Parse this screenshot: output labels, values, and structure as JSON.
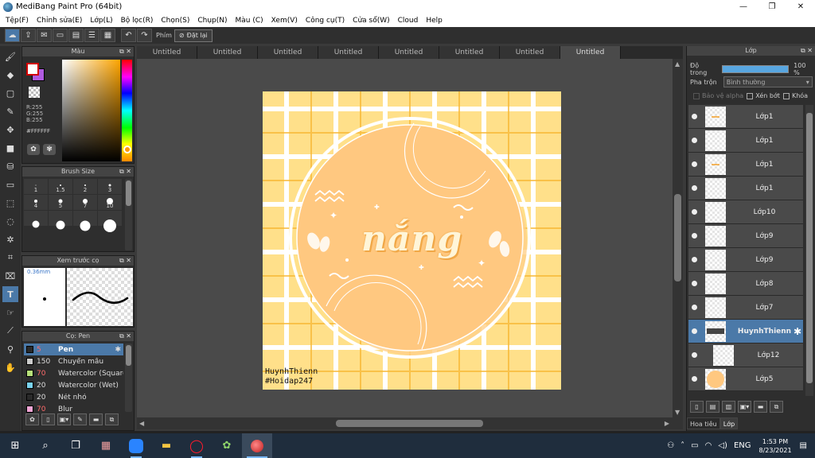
{
  "window": {
    "title": "MediBang Paint Pro (64bit)",
    "minimize": "—",
    "maximize": "❐",
    "close": "✕"
  },
  "menu": [
    "Tệp(F)",
    "Chỉnh sửa(E)",
    "Lớp(L)",
    "Bộ lọc(R)",
    "Chọn(S)",
    "Chụp(N)",
    "Màu (C)",
    "Xem(V)",
    "Công cụ(T)",
    "Cửa sổ(W)",
    "Cloud",
    "Help"
  ],
  "toolbar": {
    "hand_label": "Phím",
    "reset_label": "Đặt lại"
  },
  "color_panel": {
    "title": "Màu",
    "r": "R:255",
    "g": "G:255",
    "b": "B:255",
    "hex": "#FFFFFF",
    "fg_color": "#FFFFFF",
    "bg_color": "#B05BE0"
  },
  "brush_size": {
    "title": "Brush Size",
    "sizes": [
      "1",
      "1.5",
      "2",
      "3",
      "4",
      "5",
      "7",
      "10"
    ]
  },
  "preview": {
    "title": "Xem trước cọ",
    "size_label": "0.36mm"
  },
  "pen_panel": {
    "title": "Cọ: Pen",
    "items": [
      {
        "size": "5",
        "name": "Pen",
        "color": "#2a2a2a"
      },
      {
        "size": "150",
        "name": "Chuyển mầu",
        "color": "#cccccc"
      },
      {
        "size": "70",
        "name": "Watercolor (Square)",
        "color": "#b7e27a"
      },
      {
        "size": "20",
        "name": "Watercolor (Wet)",
        "color": "#7ad3ee"
      },
      {
        "size": "20",
        "name": "Nét nhỏ",
        "color": "#2a2a2a"
      },
      {
        "size": "70",
        "name": "Blur",
        "color": "#f2a6d6"
      }
    ]
  },
  "tabs": [
    "Untitled",
    "Untitled",
    "Untitled",
    "Untitled",
    "Untitled",
    "Untitled",
    "Untitled",
    "Untitled"
  ],
  "artwork": {
    "word": "nắng",
    "signature_line1": "HuynhThienn",
    "signature_line2": "#Hoidap247"
  },
  "layer_panel": {
    "title": "Lớp",
    "opacity_label": "Độ trong",
    "opacity_value": "100 %",
    "opacity_level": 1.0,
    "blend_label": "Pha trộn",
    "blend_value": "Bình thường",
    "protect_alpha": "Bảo vệ alpha",
    "clip": "Xén bớt",
    "lock": "Khóa",
    "layers": [
      {
        "name": "Lớp1"
      },
      {
        "name": "Lớp1"
      },
      {
        "name": "Lớp1"
      },
      {
        "name": "Lớp1"
      },
      {
        "name": "Lớp10"
      },
      {
        "name": "Lớp9"
      },
      {
        "name": "Lớp9"
      },
      {
        "name": "Lớp8"
      },
      {
        "name": "Lớp7"
      },
      {
        "name": "HuynhThienn"
      },
      {
        "name": "Lớp12"
      },
      {
        "name": "Lớp5"
      }
    ],
    "tab_navigator": "Hoa tiêu",
    "tab_layer": "Lớp"
  },
  "taskbar": {
    "lang": "ENG",
    "time": "1:53 PM",
    "date": "8/23/2021"
  }
}
